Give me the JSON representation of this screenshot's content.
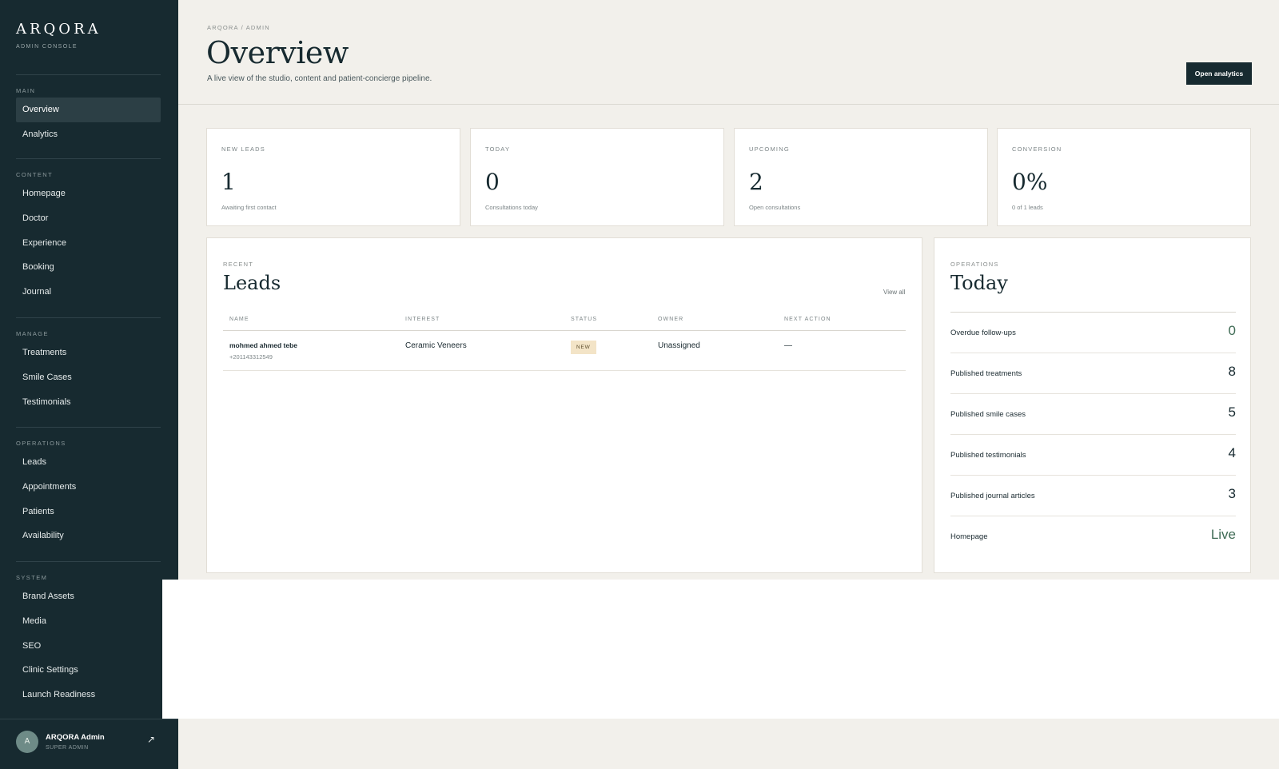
{
  "brand": {
    "name": "ARQORA",
    "subtitle": "ADMIN CONSOLE"
  },
  "sidebar": {
    "sections": [
      {
        "heading": "MAIN",
        "items": [
          "Overview",
          "Analytics"
        ]
      },
      {
        "heading": "CONTENT",
        "items": [
          "Homepage",
          "Doctor",
          "Experience",
          "Booking",
          "Journal"
        ]
      },
      {
        "heading": "MANAGE",
        "items": [
          "Treatments",
          "Smile Cases",
          "Testimonials"
        ]
      },
      {
        "heading": "OPERATIONS",
        "items": [
          "Leads",
          "Appointments",
          "Patients",
          "Availability"
        ]
      },
      {
        "heading": "SYSTEM",
        "items": [
          "Brand Assets",
          "Media",
          "SEO",
          "Clinic Settings",
          "Launch Readiness"
        ]
      }
    ],
    "active": "Overview"
  },
  "user": {
    "initial": "A",
    "name": "ARQORA Admin",
    "role": "SUPER ADMIN",
    "action_icon": "arrow-up-right-icon",
    "action_glyph": "↗"
  },
  "header": {
    "breadcrumb": "ARQORA / ADMIN",
    "title": "Overview",
    "subtitle": "A live view of the studio, content and patient-concierge pipeline.",
    "button": "Open analytics"
  },
  "stats": [
    {
      "label": "NEW LEADS",
      "value": "1",
      "note": "Awaiting first contact"
    },
    {
      "label": "TODAY",
      "value": "0",
      "note": "Consultations today"
    },
    {
      "label": "UPCOMING",
      "value": "2",
      "note": "Open consultations"
    },
    {
      "label": "CONVERSION",
      "value": "0%",
      "note": "0 of 1 leads"
    }
  ],
  "leads": {
    "eyebrow": "RECENT",
    "title": "Leads",
    "view_all": "View all",
    "columns": [
      "NAME",
      "INTEREST",
      "STATUS",
      "OWNER",
      "NEXT ACTION"
    ],
    "rows": [
      {
        "name": "mohmed ahmed tebe",
        "phone": "+201143312549",
        "interest": "Ceramic Veneers",
        "status": "NEW",
        "owner": "Unassigned",
        "next_action": "—"
      }
    ]
  },
  "today": {
    "eyebrow": "OPERATIONS",
    "title": "Today",
    "items": [
      {
        "label": "Overdue follow-ups",
        "value": "0"
      },
      {
        "label": "Published treatments",
        "value": "8"
      },
      {
        "label": "Published smile cases",
        "value": "5"
      },
      {
        "label": "Published testimonials",
        "value": "4"
      },
      {
        "label": "Published journal articles",
        "value": "3"
      },
      {
        "label": "Homepage",
        "value": "Live"
      }
    ]
  },
  "colors": {
    "sidebar": "#172a30",
    "background": "#f2f0eb",
    "accent_green": "#3f6b55",
    "badge_new": "#f3e4c7"
  }
}
